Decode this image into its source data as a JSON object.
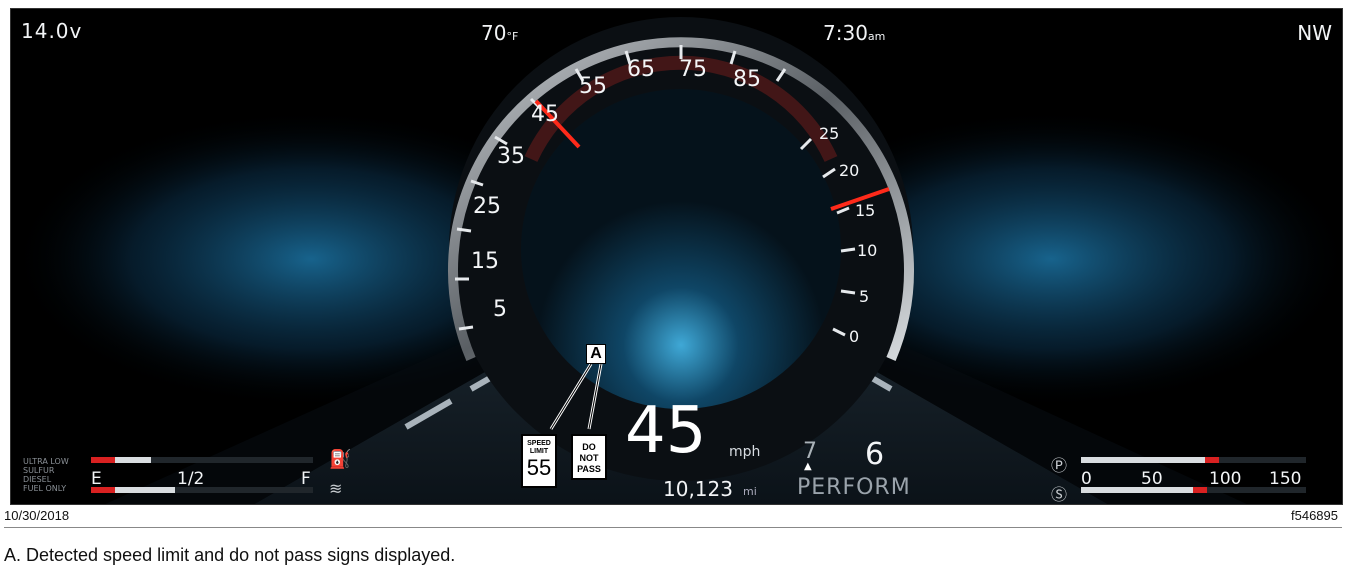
{
  "cluster": {
    "voltage": "14.0v",
    "temperature": "70",
    "temperature_unit": "°F",
    "time": "7:30",
    "time_suffix": "am",
    "compass": "NW",
    "speedometer_labels": [
      "5",
      "15",
      "25",
      "35",
      "45",
      "55",
      "65",
      "75",
      "85"
    ],
    "tach_labels": [
      "0",
      "5",
      "10",
      "15",
      "20",
      "25"
    ],
    "current_speed": "45",
    "speed_unit": "mph",
    "odometer": "10,123",
    "odometer_unit": "mi",
    "gear_small": "7",
    "gear_large": "6",
    "drive_mode": "PERFORM",
    "speed_limit_sign": {
      "line1": "SPEED",
      "line2": "LIMIT",
      "value": "55"
    },
    "do_not_pass_sign": {
      "line1": "DO",
      "line2": "NOT",
      "line3": "PASS"
    },
    "callout_label": "A",
    "fuel": {
      "label_lines": [
        "ULTRA LOW",
        "SULFUR",
        "DIESEL",
        "FUEL ONLY"
      ],
      "empty": "E",
      "half": "1/2",
      "full": "F",
      "level_fraction": 0.1
    },
    "air_pressure": {
      "labels": [
        "0",
        "50",
        "100",
        "150"
      ],
      "primary_fraction": 0.55,
      "secondary_fraction": 0.5
    }
  },
  "caption": {
    "date": "10/30/2018",
    "figure_id": "f546895",
    "description": "A.  Detected speed limit and do not pass signs displayed."
  }
}
